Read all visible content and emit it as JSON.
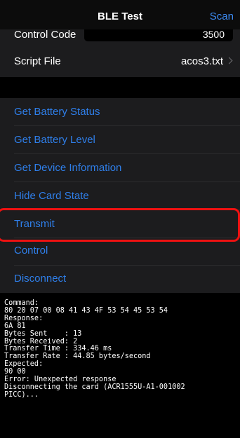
{
  "navbar": {
    "title": "BLE Test",
    "scan_label": "Scan"
  },
  "control_code": {
    "label": "Control Code",
    "value": "3500"
  },
  "script_file": {
    "label": "Script File",
    "value": "acos3.txt"
  },
  "actions": [
    {
      "label": "Get Battery Status"
    },
    {
      "label": "Get Battery Level"
    },
    {
      "label": "Get Device Information"
    },
    {
      "label": "Hide Card State"
    },
    {
      "label": "Transmit"
    },
    {
      "label": "Control"
    },
    {
      "label": "Disconnect"
    }
  ],
  "console_lines": [
    "Command:",
    "80 20 07 00 08 41 43 4F 53 54 45 53 54",
    "Response:",
    "6A 81",
    "Bytes Sent    : 13",
    "Bytes Received: 2",
    "Transfer Time : 334.46 ms",
    "Transfer Rate : 44.85 bytes/second",
    "Expected:",
    "90 00",
    "Error: Unexpected response",
    "Disconnecting the card (ACR1555U-A1-001002",
    "PICC)..."
  ],
  "colors": {
    "accent": "#2f7fea",
    "highlight": "#e11111",
    "row_bg": "#1c1c1e"
  }
}
